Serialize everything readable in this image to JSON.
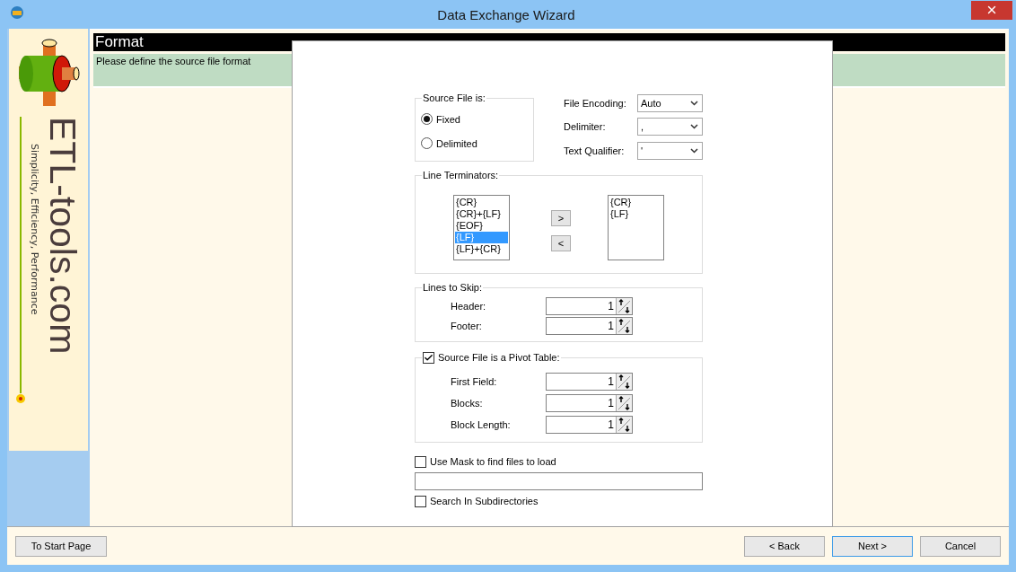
{
  "window": {
    "title": "Data Exchange Wizard"
  },
  "logo": {
    "name": "ETL-tools.com",
    "tagline": "Simplicity, Efficiency, Performance"
  },
  "header": {
    "title": "Format",
    "description": "Please define the source file format"
  },
  "source_file": {
    "label": "Source File is:",
    "options": [
      {
        "label": "Fixed",
        "selected": true
      },
      {
        "label": "Delimited",
        "selected": false
      }
    ]
  },
  "settings": [
    {
      "label": "File Encoding:",
      "value": "Auto"
    },
    {
      "label": "Delimiter:",
      "value": ","
    },
    {
      "label": "Text Qualifier:",
      "value": "'"
    }
  ],
  "line_terminators": {
    "label": "Line Terminators:",
    "available": [
      {
        "label": "{CR}",
        "selected": false
      },
      {
        "label": "{CR}+{LF}",
        "selected": false
      },
      {
        "label": "{EOF}",
        "selected": false
      },
      {
        "label": "{LF}",
        "selected": true
      },
      {
        "label": "{LF}+{CR}",
        "selected": false
      }
    ],
    "add_button": ">",
    "remove_button": "<",
    "chosen": [
      {
        "label": "{CR}",
        "selected": false
      },
      {
        "label": "{LF}",
        "selected": false
      }
    ]
  },
  "lines_to_skip": {
    "label": "Lines to Skip:",
    "fields": [
      {
        "label": "Header:",
        "value": "1"
      },
      {
        "label": "Footer:",
        "value": "1"
      }
    ]
  },
  "pivot": {
    "label": "Source File is a Pivot Table:",
    "checked": true,
    "fields": [
      {
        "label": "First Field:",
        "value": "1"
      },
      {
        "label": "Blocks:",
        "value": "1"
      },
      {
        "label": "Block Length:",
        "value": "1"
      }
    ]
  },
  "mask": {
    "label": "Use Mask to find files to load",
    "checked": false
  },
  "search_subdirectories": {
    "label": "Search In Subdirectories",
    "checked": false
  },
  "start_button": {
    "label": "To Start Page",
    "default": false
  },
  "nav_buttons": [
    {
      "label": "< Back",
      "default": false
    },
    {
      "label": "Next >",
      "default": true
    },
    {
      "label": "Cancel",
      "default": false
    }
  ]
}
